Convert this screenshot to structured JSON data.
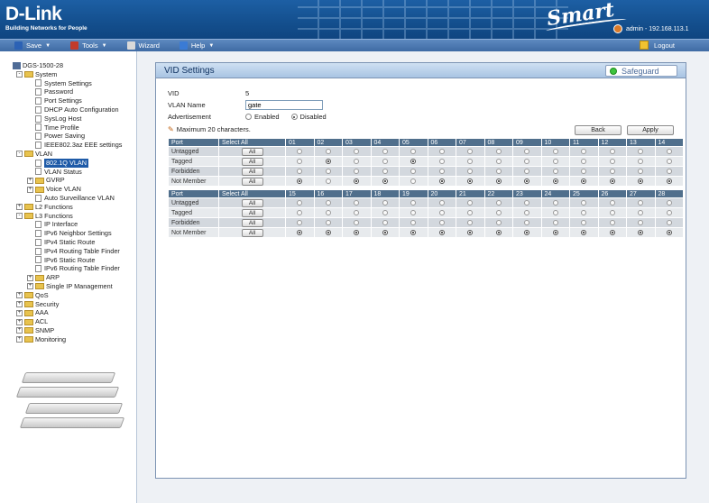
{
  "header": {
    "brand": "D-Link",
    "tagline": "Building Networks for People",
    "product_mark": "Smart",
    "user": "admin - 192.168.113.1"
  },
  "menu": {
    "items": [
      {
        "label": "Save",
        "icon": "save-icon",
        "dropdown": true
      },
      {
        "label": "Tools",
        "icon": "tools-icon",
        "dropdown": true
      },
      {
        "label": "Wizard",
        "icon": "wizard-icon",
        "dropdown": false
      },
      {
        "label": "Help",
        "icon": "help-icon",
        "dropdown": true
      }
    ],
    "logout": "Logout"
  },
  "tree": {
    "root": "DGS-1500-28",
    "nodes": [
      {
        "label": "System",
        "type": "folder",
        "level": 1,
        "toggle": "-"
      },
      {
        "label": "System Settings",
        "type": "page",
        "level": 2
      },
      {
        "label": "Password",
        "type": "page",
        "level": 2
      },
      {
        "label": "Port Settings",
        "type": "page",
        "level": 2
      },
      {
        "label": "DHCP Auto Configuration",
        "type": "page",
        "level": 2
      },
      {
        "label": "SysLog Host",
        "type": "page",
        "level": 2
      },
      {
        "label": "Time Profile",
        "type": "page",
        "level": 2
      },
      {
        "label": "Power Saving",
        "type": "page",
        "level": 2
      },
      {
        "label": "IEEE802.3az EEE settings",
        "type": "page",
        "level": 2
      },
      {
        "label": "VLAN",
        "type": "folder",
        "level": 1,
        "toggle": "-"
      },
      {
        "label": "802.1Q VLAN",
        "type": "page",
        "level": 2,
        "selected": true
      },
      {
        "label": "VLAN Status",
        "type": "page",
        "level": 2
      },
      {
        "label": "GVRP",
        "type": "folder",
        "level": 2,
        "toggle": "+"
      },
      {
        "label": "Voice VLAN",
        "type": "folder",
        "level": 2,
        "toggle": "+"
      },
      {
        "label": "Auto Surveillance VLAN",
        "type": "page",
        "level": 2
      },
      {
        "label": "L2 Functions",
        "type": "folder",
        "level": 1,
        "toggle": "+"
      },
      {
        "label": "L3 Functions",
        "type": "folder",
        "level": 1,
        "toggle": "-"
      },
      {
        "label": "IP Interface",
        "type": "page",
        "level": 2
      },
      {
        "label": "IPv6 Neighbor Settings",
        "type": "page",
        "level": 2
      },
      {
        "label": "IPv4 Static Route",
        "type": "page",
        "level": 2
      },
      {
        "label": "IPv4 Routing Table Finder",
        "type": "page",
        "level": 2
      },
      {
        "label": "IPv6 Static Route",
        "type": "page",
        "level": 2
      },
      {
        "label": "IPv6 Routing Table Finder",
        "type": "page",
        "level": 2
      },
      {
        "label": "ARP",
        "type": "folder",
        "level": 2,
        "toggle": "+"
      },
      {
        "label": "Single IP Management",
        "type": "folder",
        "level": 2,
        "toggle": "+"
      },
      {
        "label": "QoS",
        "type": "folder",
        "level": 1,
        "toggle": "+"
      },
      {
        "label": "Security",
        "type": "folder",
        "level": 1,
        "toggle": "+"
      },
      {
        "label": "AAA",
        "type": "folder",
        "level": 1,
        "toggle": "+"
      },
      {
        "label": "ACL",
        "type": "folder",
        "level": 1,
        "toggle": "+"
      },
      {
        "label": "SNMP",
        "type": "folder",
        "level": 1,
        "toggle": "+"
      },
      {
        "label": "Monitoring",
        "type": "folder",
        "level": 1,
        "toggle": "+"
      }
    ]
  },
  "panel": {
    "title": "VID Settings",
    "safeguard": "Safeguard",
    "vid_label": "VID",
    "vid_value": "5",
    "vlan_name_label": "VLAN Name",
    "vlan_name_value": "gate",
    "advertisement_label": "Advertisement",
    "adv_enabled": "Enabled",
    "adv_disabled": "Disabled",
    "advertisement_selected": "Disabled",
    "hint": "Maximum 20 characters.",
    "back": "Back",
    "apply": "Apply"
  },
  "port_table": {
    "port_header": "Port",
    "select_all_header": "Select All",
    "all_label": "All",
    "rows": [
      "Untagged",
      "Tagged",
      "Forbidden",
      "Not Member"
    ],
    "groups": [
      {
        "ports": [
          "01",
          "02",
          "03",
          "04",
          "05",
          "06",
          "07",
          "08",
          "09",
          "10",
          "11",
          "12",
          "13",
          "14"
        ],
        "selected_row": [
          "Not Member",
          "Tagged",
          "Not Member",
          "Not Member",
          "Tagged",
          "Not Member",
          "Not Member",
          "Not Member",
          "Not Member",
          "Not Member",
          "Not Member",
          "Not Member",
          "Not Member",
          "Not Member"
        ]
      },
      {
        "ports": [
          "15",
          "16",
          "17",
          "18",
          "19",
          "20",
          "21",
          "22",
          "23",
          "24",
          "25",
          "26",
          "27",
          "28"
        ],
        "selected_row": [
          "Not Member",
          "Not Member",
          "Not Member",
          "Not Member",
          "Not Member",
          "Not Member",
          "Not Member",
          "Not Member",
          "Not Member",
          "Not Member",
          "Not Member",
          "Not Member",
          "Not Member",
          "Not Member"
        ]
      }
    ]
  }
}
